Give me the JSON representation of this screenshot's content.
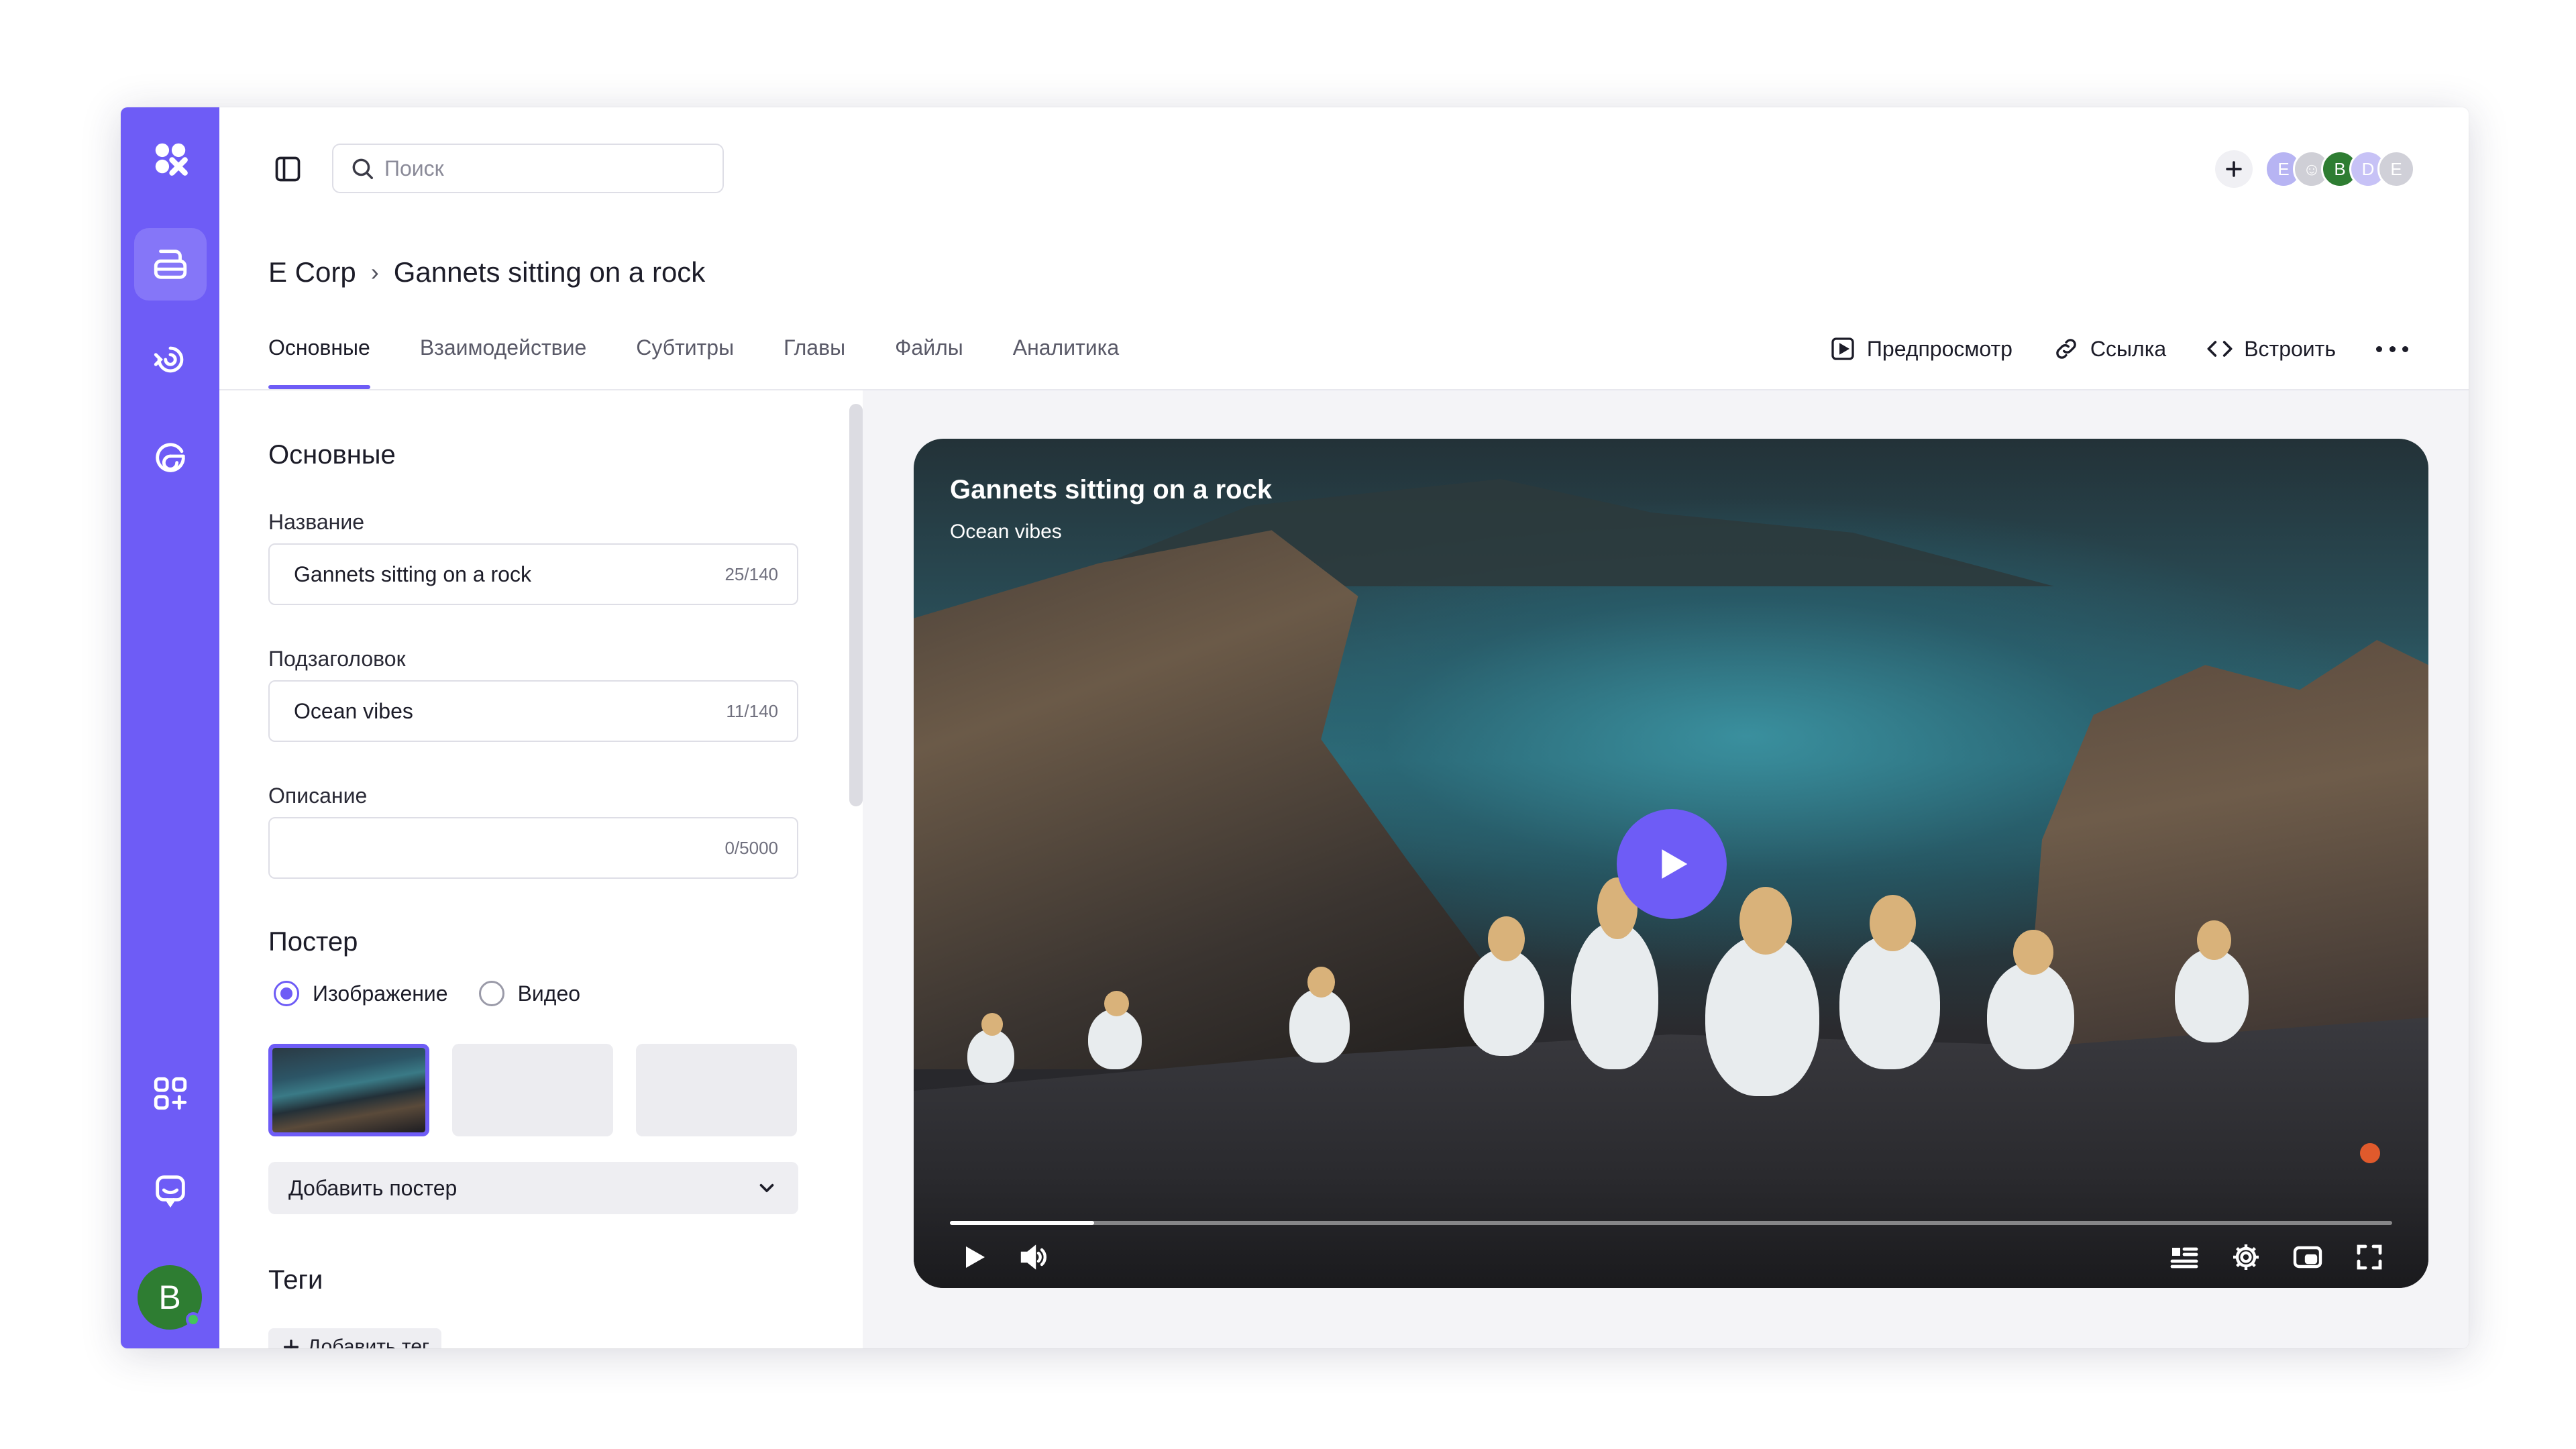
{
  "search": {
    "placeholder": "Поиск"
  },
  "collaborators": [
    {
      "initial": "E",
      "color": "#b7b4f3"
    },
    {
      "initial": "☺",
      "color": "#cfcfd6"
    },
    {
      "initial": "B",
      "color": "#2e7d32"
    },
    {
      "initial": "D",
      "color": "#c7c2f6"
    },
    {
      "initial": "E",
      "color": "#d0d0d8"
    }
  ],
  "user": {
    "initial": "B"
  },
  "breadcrumb": {
    "org": "E Corp",
    "separator": "›",
    "title": "Gannets sitting on a rock"
  },
  "tabs": [
    {
      "label": "Основные",
      "active": true
    },
    {
      "label": "Взаимодействие"
    },
    {
      "label": "Субтитры"
    },
    {
      "label": "Главы"
    },
    {
      "label": "Файлы"
    },
    {
      "label": "Аналитика"
    }
  ],
  "actions": {
    "preview": "Предпросмотр",
    "link": "Ссылка",
    "embed": "Встроить"
  },
  "form": {
    "section_main": "Основные",
    "name_label": "Название",
    "name_value": "Gannets sitting on a rock",
    "name_count": "25/140",
    "subtitle_label": "Подзаголовок",
    "subtitle_value": "Ocean vibes",
    "subtitle_count": "11/140",
    "description_label": "Описание",
    "description_value": "",
    "description_count": "0/5000",
    "section_poster": "Постер",
    "poster_option_image": "Изображение",
    "poster_option_video": "Видео",
    "add_poster": "Добавить постер",
    "section_tags": "Теги",
    "add_tag": "Добавить тег"
  },
  "player": {
    "title": "Gannets sitting on a rock",
    "subtitle": "Ocean vibes",
    "progress": 0.1
  },
  "colors": {
    "accent": "#6e5cf6",
    "rail": "#6e5cf6"
  }
}
